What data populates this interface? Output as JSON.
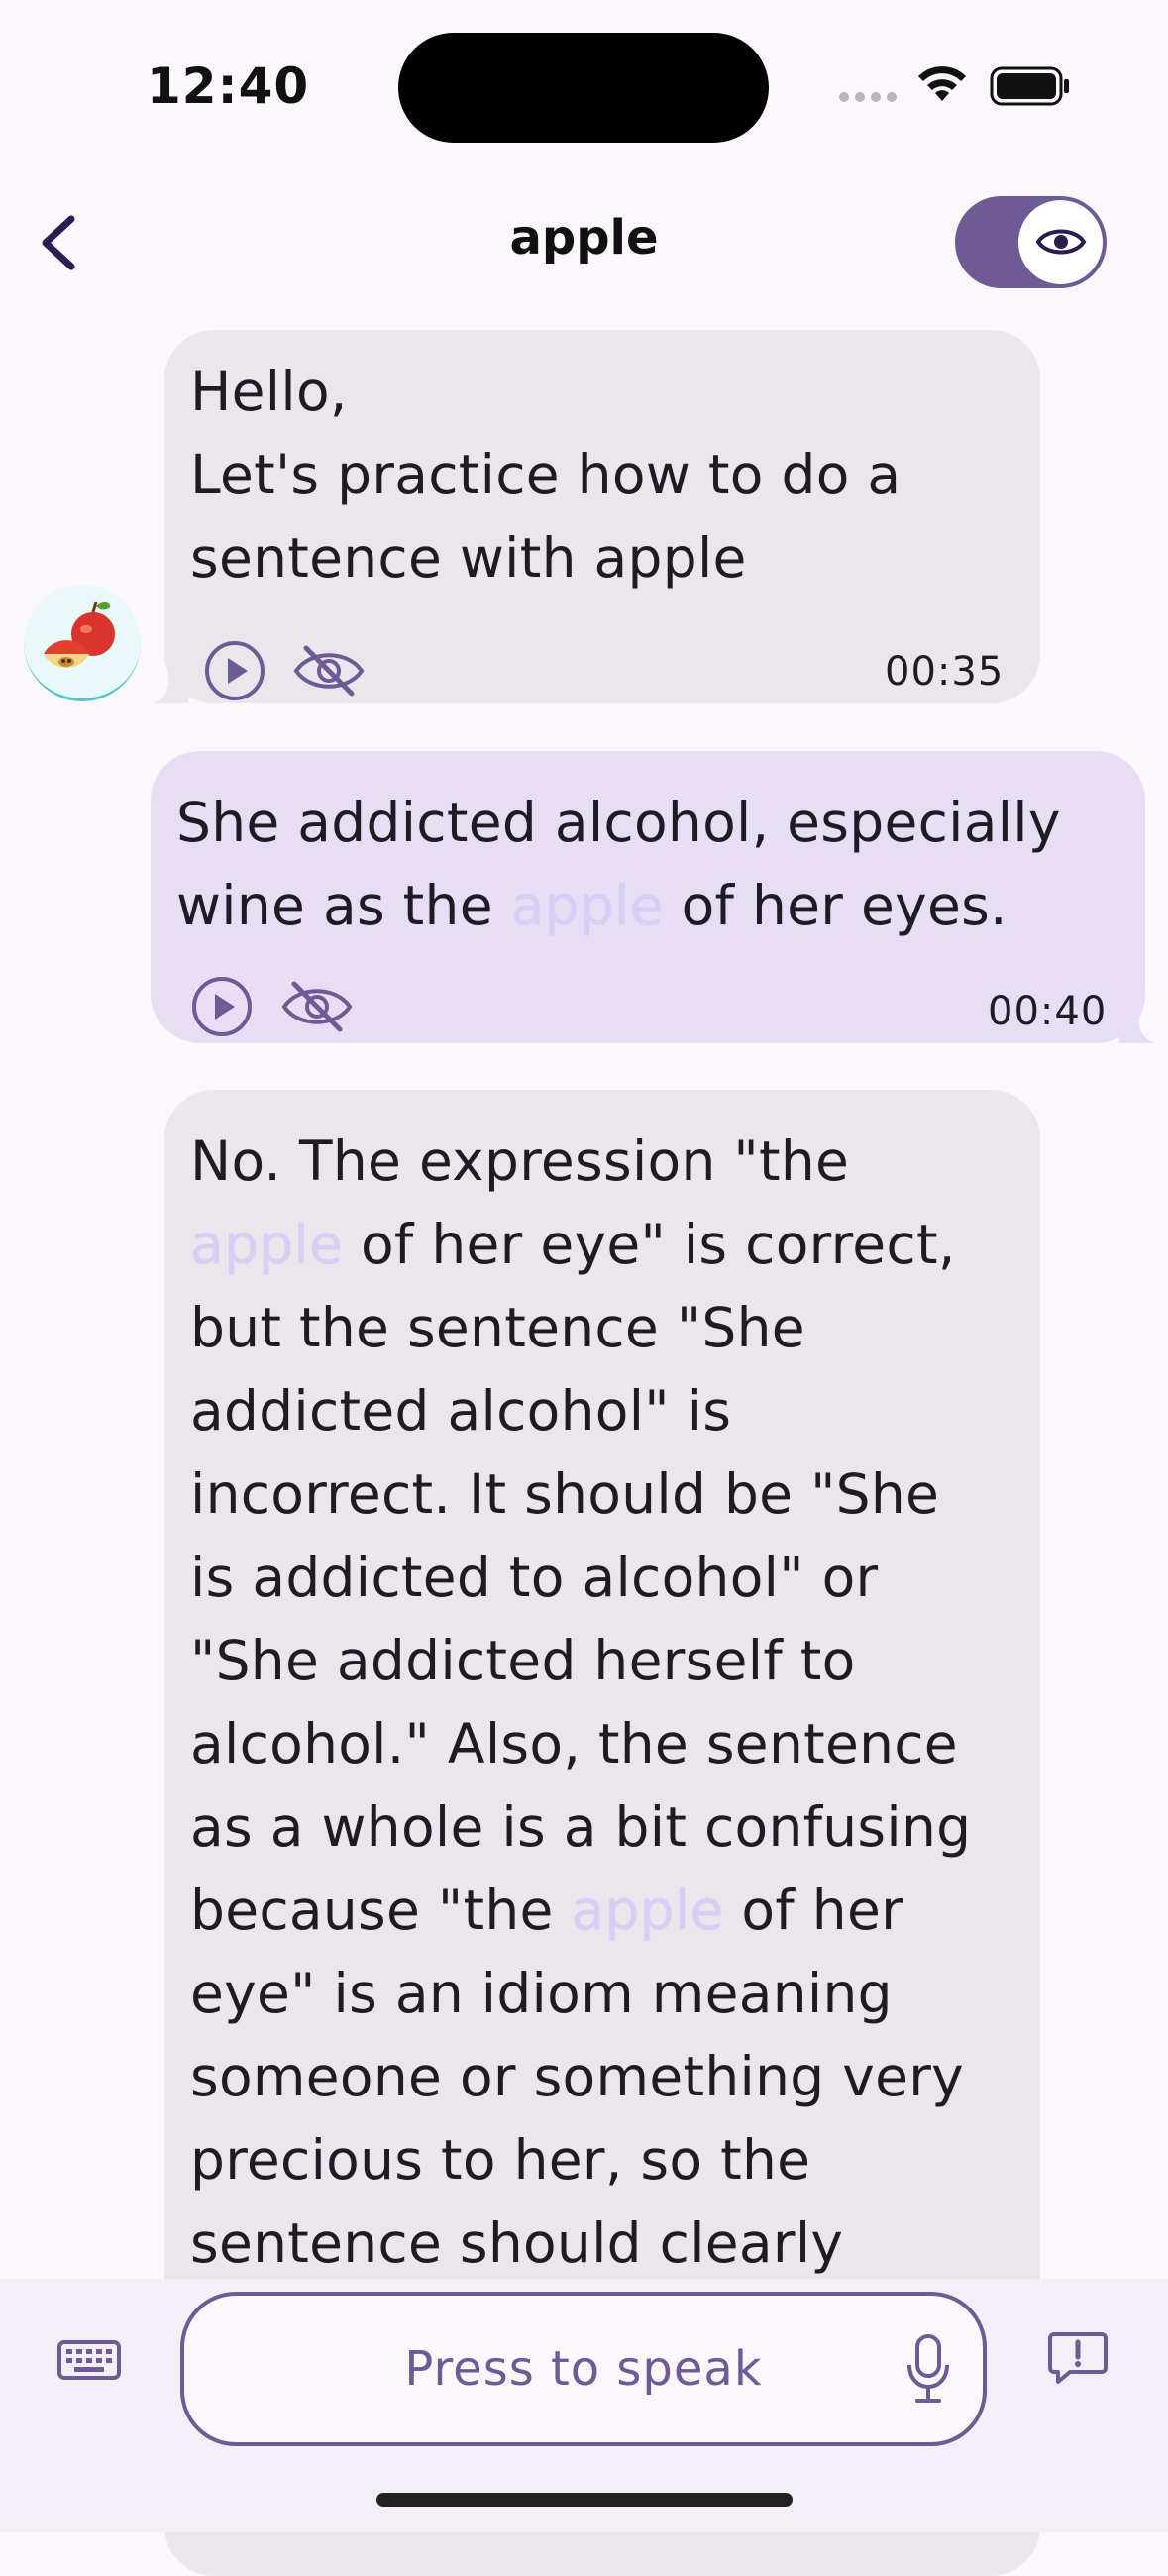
{
  "status": {
    "time": "12:40"
  },
  "header": {
    "title": "apple",
    "reveal_toggle_on": true
  },
  "colors": {
    "accent": "#6e5a95",
    "bot_bubble": "#ebe6ec",
    "user_bubble": "#e7def6",
    "highlight": "#d8cdf5"
  },
  "messages": [
    {
      "role": "bot",
      "lines": [
        "Hello,",
        "Let's practice how to do a",
        "sentence with apple"
      ],
      "time": "00:35"
    },
    {
      "role": "user",
      "line1": "She addicted alcohol, especially",
      "line2_pre": "wine as the ",
      "line2_hl": "apple",
      "line2_post": " of her eyes.",
      "time": "00:40"
    },
    {
      "role": "bot",
      "l1": "No. The expression \"the",
      "l2_hl": "apple",
      "l2_post": " of her eye\" is correct,",
      "l3": "but the sentence \"She",
      "l4": "addicted alcohol\" is",
      "l5": "incorrect. It should be \"She",
      "l6": "is addicted to alcohol\" or",
      "l7": "\"She addicted herself to",
      "l8": "alcohol.\" Also, the sentence",
      "l9": "as a whole is a bit confusing",
      "l10_pre": "because \"the ",
      "l10_hl": "apple",
      "l10_post": " of her",
      "l11": "eye\" is an idiom meaning",
      "l12": "someone or something very",
      "l13": "precious to her, so the",
      "l14": "sentence should clearly"
    }
  ],
  "input": {
    "placeholder": "Press to speak"
  },
  "icons": {
    "back": "chevron-left-icon",
    "toggle": "eye-icon",
    "play": "play-icon",
    "hide": "eye-off-icon",
    "keyboard": "keyboard-icon",
    "mic": "microphone-icon",
    "feedback": "feedback-icon"
  }
}
